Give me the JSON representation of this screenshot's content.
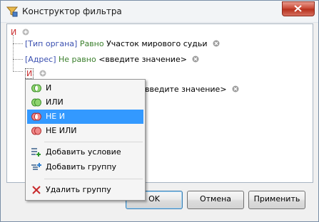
{
  "window": {
    "title": "Конструктор фильтра"
  },
  "tree": {
    "root_op": "И",
    "rows": [
      {
        "field": "[Тип органа]",
        "operator": "Равно",
        "value": "Участок мирового судьи"
      },
      {
        "field": "[Адрес]",
        "operator": "Не равно",
        "value": "<введите значение>"
      }
    ],
    "group_op": "И",
    "hidden_value": "введите значение>"
  },
  "menu": {
    "items": [
      {
        "label": "И",
        "icon": "group-and-icon",
        "color": "#3ea63a"
      },
      {
        "label": "ИЛИ",
        "icon": "group-or-icon",
        "color": "#3ea63a"
      },
      {
        "label": "НЕ И",
        "icon": "group-not-and-icon",
        "color": "#d23b3b",
        "selected": true
      },
      {
        "label": "НЕ ИЛИ",
        "icon": "group-not-or-icon",
        "color": "#d23b3b"
      },
      {
        "label": "Добавить условие",
        "icon": "add-condition-icon"
      },
      {
        "label": "Добавить группу",
        "icon": "add-group-icon"
      },
      {
        "label": "Удалить группу",
        "icon": "delete-group-icon"
      }
    ]
  },
  "buttons": {
    "ok": "OK",
    "cancel": "Отмена",
    "apply": "Применить"
  }
}
